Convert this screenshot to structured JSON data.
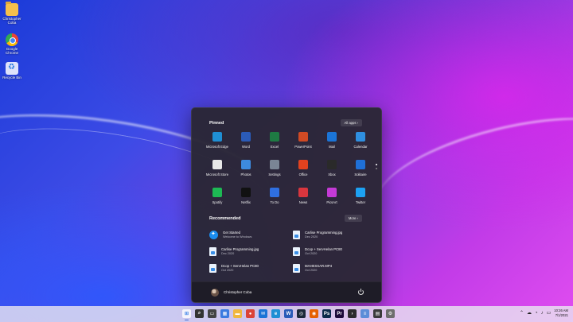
{
  "desktop": {
    "icons": [
      {
        "label": "Christopher Coba",
        "icon": "folder-icon"
      },
      {
        "label": "Google Chrome",
        "icon": "chrome-icon"
      },
      {
        "label": "Recycle Bin",
        "icon": "recycle-bin-icon"
      }
    ]
  },
  "start_menu": {
    "pinned": {
      "title": "Pinned",
      "all_apps_label": "All apps",
      "apps": [
        {
          "label": "Microsoft Edge",
          "icon": "edge-icon",
          "color": "#1f8fd4"
        },
        {
          "label": "Word",
          "icon": "word-icon",
          "color": "#2b5bb8"
        },
        {
          "label": "Excel",
          "icon": "excel-icon",
          "color": "#1e7a43"
        },
        {
          "label": "PowerPoint",
          "icon": "powerpoint-icon",
          "color": "#d04a24"
        },
        {
          "label": "Mail",
          "icon": "mail-icon",
          "color": "#1b74d6"
        },
        {
          "label": "Calendar",
          "icon": "calendar-icon",
          "color": "#2f8fe0"
        },
        {
          "label": "Microsoft Store",
          "icon": "store-icon",
          "color": "#e8e8e8"
        },
        {
          "label": "Photos",
          "icon": "photos-icon",
          "color": "#3d8be0"
        },
        {
          "label": "Settings",
          "icon": "settings-icon",
          "color": "#7a8595"
        },
        {
          "label": "Office",
          "icon": "office-icon",
          "color": "#e2421f"
        },
        {
          "label": "Xbox",
          "icon": "xbox-icon",
          "color": "#2a2a2a"
        },
        {
          "label": "Solitaire",
          "icon": "solitaire-icon",
          "color": "#1f6fd6"
        },
        {
          "label": "Spotify",
          "icon": "spotify-icon",
          "color": "#1db954"
        },
        {
          "label": "Netflix",
          "icon": "netflix-icon",
          "color": "#111111"
        },
        {
          "label": "To Do",
          "icon": "todo-icon",
          "color": "#2f6fe0"
        },
        {
          "label": "News",
          "icon": "news-icon",
          "color": "#d9363e"
        },
        {
          "label": "PicsArt",
          "icon": "picsart-icon",
          "color": "#c43ad6"
        },
        {
          "label": "Twitter",
          "icon": "twitter-icon",
          "color": "#1da1f2"
        }
      ]
    },
    "recommended": {
      "title": "Recommended",
      "more_label": "More",
      "items": [
        {
          "name": "Get Started",
          "sub": "Welcome to Windows",
          "icon": "get-started-icon"
        },
        {
          "name": "Carlise Programming.jpg",
          "sub": "Dec 2020",
          "icon": "image-file-icon"
        },
        {
          "name": "Carlise Programming.jpg",
          "sub": "Dec 2020",
          "icon": "image-file-icon"
        },
        {
          "name": "Dcop + ServHelan PC80",
          "sub": "Oct 2020",
          "icon": "document-file-icon"
        },
        {
          "name": "Dcop + ServHelan PC80",
          "sub": "Oct 2020",
          "icon": "document-file-icon"
        },
        {
          "name": "MAHESSAR.MP4",
          "sub": "Oct 2020",
          "icon": "video-file-icon"
        }
      ]
    },
    "user": {
      "name": "Christopher Coba"
    }
  },
  "taskbar": {
    "apps": [
      {
        "icon": "windows-start-icon",
        "color": "#2b78e4",
        "glyph": "⊞",
        "active": true
      },
      {
        "icon": "search-icon",
        "color": "#333333",
        "glyph": "⌕",
        "active": false
      },
      {
        "icon": "task-view-icon",
        "color": "#444444",
        "glyph": "▭",
        "active": false
      },
      {
        "icon": "widgets-icon",
        "color": "#3a7be0",
        "glyph": "▦",
        "active": false
      },
      {
        "icon": "file-explorer-icon",
        "color": "#f0b73d",
        "glyph": "▬",
        "active": false
      },
      {
        "icon": "chrome-icon",
        "color": "#db4437",
        "glyph": "●",
        "active": false
      },
      {
        "icon": "mail-icon",
        "color": "#1b74d6",
        "glyph": "✉",
        "active": false
      },
      {
        "icon": "edge-icon",
        "color": "#1f8fd4",
        "glyph": "e",
        "active": false
      },
      {
        "icon": "word-icon",
        "color": "#2b5bb8",
        "glyph": "W",
        "active": false
      },
      {
        "icon": "steam-icon",
        "color": "#1b2838",
        "glyph": "◎",
        "active": false
      },
      {
        "icon": "firefox-icon",
        "color": "#e66000",
        "glyph": "◉",
        "active": false
      },
      {
        "icon": "photoshop-icon",
        "color": "#0b2a4a",
        "glyph": "Ps",
        "active": false
      },
      {
        "icon": "premiere-icon",
        "color": "#1d0a3a",
        "glyph": "Pr",
        "active": false
      },
      {
        "icon": "terminal-icon",
        "color": "#2d2d2d",
        "glyph": "›",
        "active": false
      },
      {
        "icon": "notepad-icon",
        "color": "#5b8dd8",
        "glyph": "≡",
        "active": false
      },
      {
        "icon": "calculator-icon",
        "color": "#3b3b3b",
        "glyph": "▤",
        "active": false
      },
      {
        "icon": "settings-icon",
        "color": "#6e6e6e",
        "glyph": "⚙",
        "active": false
      }
    ],
    "clock": {
      "time": "10:26 AM",
      "date": "7/1/2021"
    }
  }
}
